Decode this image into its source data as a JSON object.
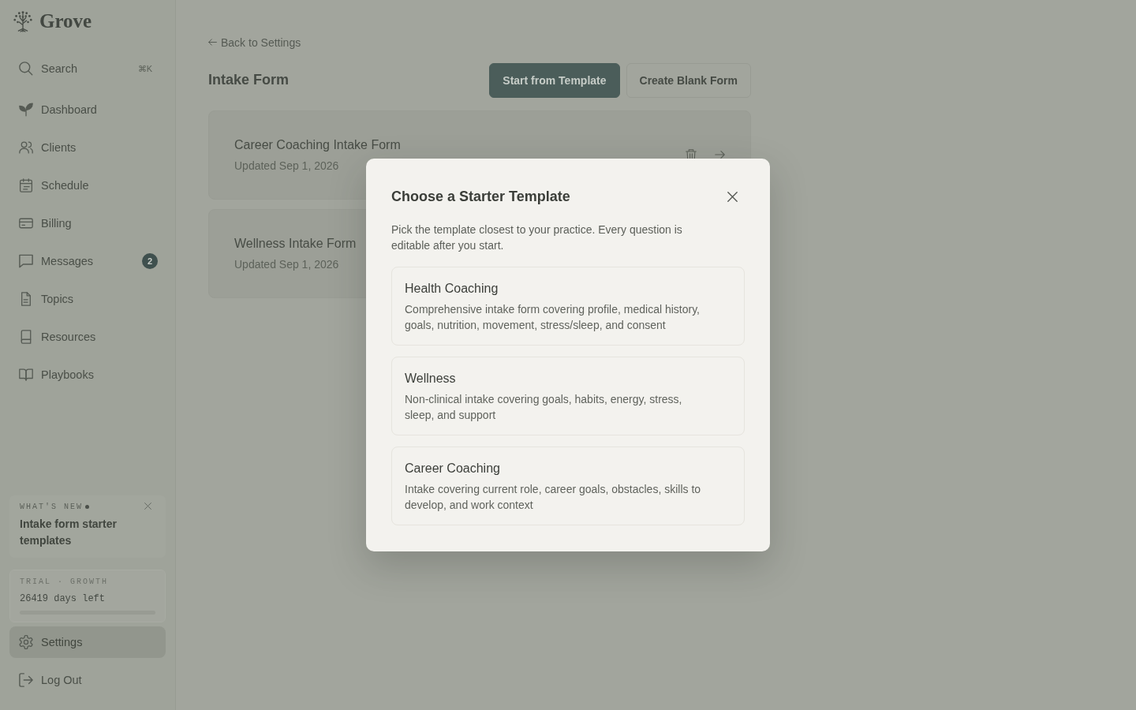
{
  "sidebar": {
    "logo": "Grove",
    "search": {
      "label": "Search",
      "shortcut": "⌘K"
    },
    "nav": [
      {
        "label": "Dashboard",
        "selected": false
      },
      {
        "label": "Clients",
        "selected": false
      },
      {
        "label": "Schedule",
        "selected": false
      },
      {
        "label": "Billing",
        "selected": false
      },
      {
        "label": "Messages",
        "selected": false,
        "badge": "2"
      },
      {
        "label": "Topics",
        "selected": false
      },
      {
        "label": "Resources",
        "selected": false
      },
      {
        "label": "Playbooks",
        "selected": false
      }
    ],
    "whats_new": {
      "label": "WHAT'S NEW",
      "unread": true,
      "title": "Intake form starter templates"
    },
    "trial": {
      "label": "TRIAL · GROWTH",
      "remaining": "26419 days left",
      "level": 0
    },
    "footer": [
      {
        "label": "Settings",
        "selected": true
      },
      {
        "label": "Log Out",
        "selected": false
      }
    ]
  },
  "page": {
    "back_link": "Back to Settings",
    "title": "Intake Form",
    "buttons": [
      {
        "label": "Start from Template",
        "kind": "primary"
      },
      {
        "label": "Create Blank Form",
        "kind": "secondary"
      }
    ],
    "forms": [
      {
        "title": "Career Coaching Intake Form",
        "updated": "Updated Sep 1, 2026",
        "actions_visible": true
      },
      {
        "title": "Wellness Intake Form",
        "updated": "Updated Sep 1, 2026"
      }
    ]
  },
  "modal": {
    "title": "Choose a Starter Template",
    "description": "Pick the template closest to your practice. Every question is editable after you start.",
    "templates": [
      {
        "name": "Health Coaching",
        "description": "Comprehensive intake form covering profile, medical history, goals, nutrition, movement, stress/sleep, and consent"
      },
      {
        "name": "Wellness",
        "description": "Non-clinical intake covering goals, habits, energy, stress, sleep, and support"
      },
      {
        "name": "Career Coaching",
        "description": "Intake covering current role, career goals, obstacles, skills to develop, and work context"
      }
    ]
  }
}
